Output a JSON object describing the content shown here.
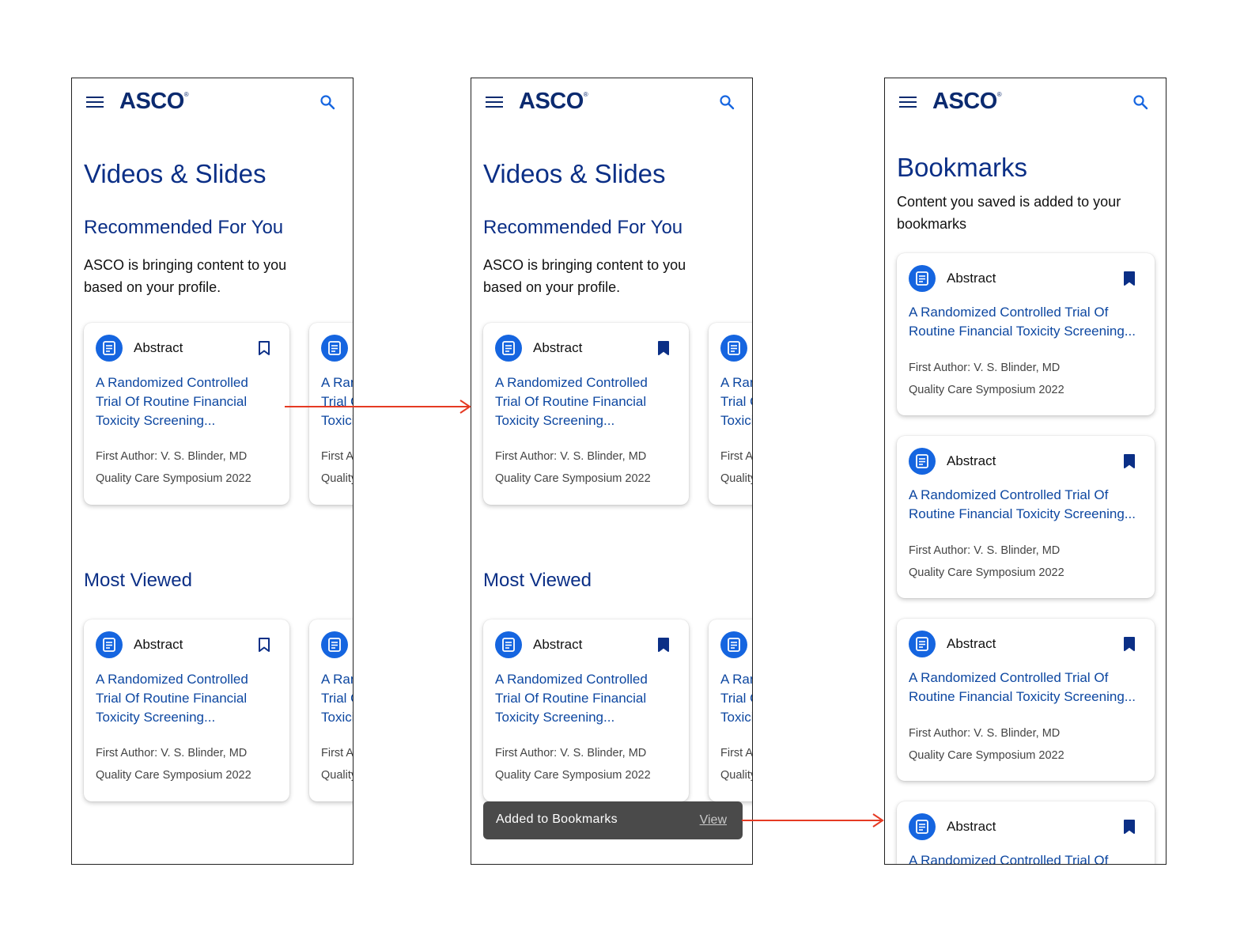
{
  "brand": {
    "name": "ASCO",
    "mark": "®"
  },
  "screens": {
    "videos": {
      "page_title": "Videos & Slides",
      "recommended": {
        "heading": "Recommended For You",
        "description": "ASCO is bringing content to you based on your profile."
      },
      "most_viewed": {
        "heading": "Most Viewed"
      }
    },
    "bookmarks": {
      "page_title": "Bookmarks",
      "description": "Content you saved is added to your bookmarks"
    }
  },
  "card": {
    "type": "Abstract",
    "title": "A Randomized Controlled Trial Of Routine Financial Toxicity Screening...",
    "title_peek": "A Randomized Controlled Trial Of Routine Financial Toxicity Screening...",
    "author": "First Author: V. S. Blinder, MD",
    "venue": "Quality Care Symposium 2022"
  },
  "toast": {
    "message": "Added to Bookmarks",
    "action": "View"
  },
  "colors": {
    "brand": "#0b2a6f",
    "heading": "#0b2f86",
    "link": "#0d47a1",
    "icon": "#1565e0",
    "arrow": "#e53a23"
  },
  "icons": {
    "menu": "hamburger-icon",
    "search": "search-icon",
    "document": "document-icon",
    "bookmark": "bookmark-icon"
  }
}
